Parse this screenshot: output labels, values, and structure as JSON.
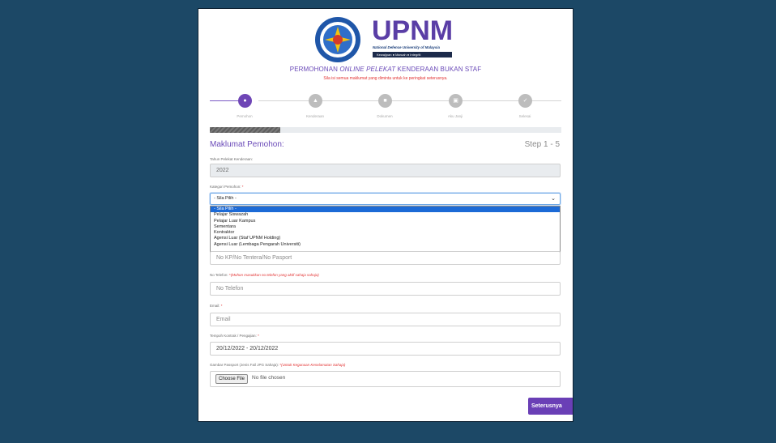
{
  "colors": {
    "background": "#1c4866",
    "accent": "#6a4ab8",
    "required": "#e23030",
    "selection": "#1c6ad6"
  },
  "header": {
    "logo_text": "UPNM",
    "logo_subtitle": "National Defence University of Malaysia",
    "logo_motto": "Kewajipan ● Maruah ● Integriti",
    "title_prefix": "PERMOHONAN",
    "title_online": "ONLINE",
    "title_pelekat": "PELEKAT",
    "title_suffix": "KENDERAAN BUKAN STAF",
    "subtitle": "Sila isi semua maklumat yang diminta untuk ke peringkat seterusnya."
  },
  "stepper": {
    "progress_fraction": 0.2,
    "steps": [
      {
        "label": "Pemohon",
        "icon": "user-icon",
        "active": true
      },
      {
        "label": "Kenderaan",
        "icon": "car-icon",
        "active": false
      },
      {
        "label": "Dokumen",
        "icon": "document-icon",
        "active": false
      },
      {
        "label": "Aku Janji",
        "icon": "calendar-icon",
        "active": false
      },
      {
        "label": "Selesai",
        "icon": "check-icon",
        "active": false
      }
    ]
  },
  "section": {
    "title": "Maklumat Pemohon:",
    "step": "Step 1 - 5"
  },
  "form": {
    "tahun": {
      "label": "Tahun Pelekat Kenderaan:",
      "value": "2022"
    },
    "kategori": {
      "label": "Kategori Pemohon:",
      "required": "*",
      "value": "- Sila Pilih -",
      "options": [
        "- Sila Pilih -",
        "Pelajar Siswazah",
        "Pelajar Luar Kampus",
        "Sementara",
        "Kontraktor",
        "Agensi Luar (Staf UPNM Holding)",
        "Agensi Luar (Lembaga Pengarah Universiti)"
      ]
    },
    "kp": {
      "placeholder": "No KP/No Tentera/No Pasport"
    },
    "telefon": {
      "label": "No Telefon:",
      "required": "*",
      "note": "(Mohon masukkan no telefon yang aktif sahaja sahaja)",
      "placeholder": "No Telefon"
    },
    "email": {
      "label": "Email:",
      "required": "*",
      "placeholder": "Email"
    },
    "tempoh": {
      "label": "Tempoh Kontrak / Pengajian:",
      "required": "*",
      "value": "20/12/2022 - 20/12/2022"
    },
    "gambar": {
      "label": "Gambar Passport (Jenis Fail JPG Sahaja):",
      "required": "*",
      "note": "(Untuk Kegunaan Keselamatan Sahaja)",
      "button": "Choose File",
      "status": "No file chosen"
    }
  },
  "next_button": "Seterusnya"
}
